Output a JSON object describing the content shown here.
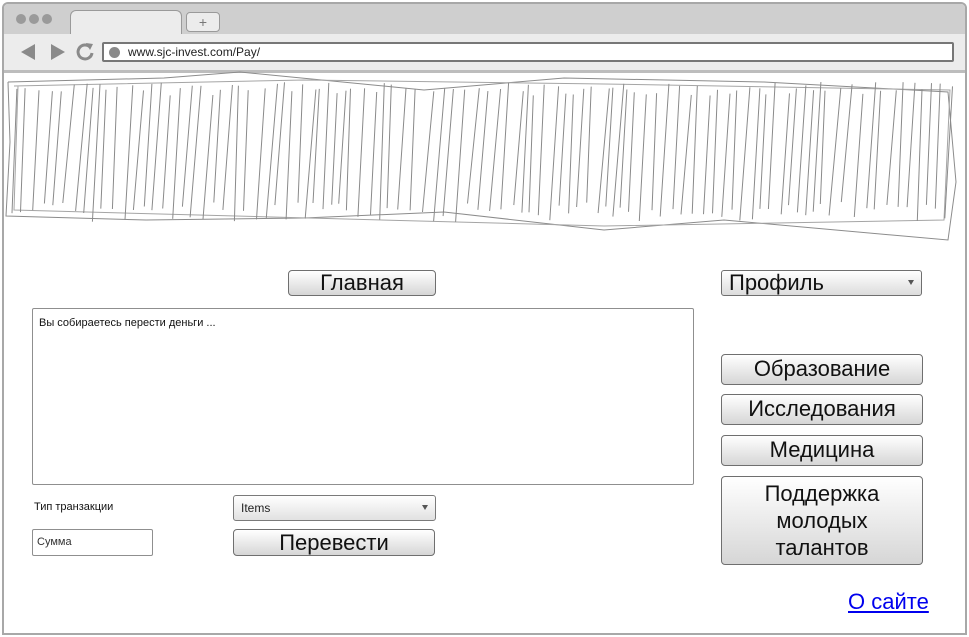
{
  "browser": {
    "url": "www.sjc-invest.com/Pay/",
    "new_tab_label": "+"
  },
  "nav": {
    "home_label": "Главная",
    "profile_label": "Профиль"
  },
  "categories": [
    {
      "label": "Образование"
    },
    {
      "label": "Исследования"
    },
    {
      "label": "Медицина"
    },
    {
      "label": "Поддержка молодых талантов"
    }
  ],
  "main": {
    "message": "Вы собираетесь перести деньги ..."
  },
  "form": {
    "transaction_type_label": "Тип транзакции",
    "transaction_type_value": "Items",
    "amount_placeholder": "Сумма",
    "transfer_label": "Перевести"
  },
  "footer": {
    "about_label": "О сайте"
  }
}
